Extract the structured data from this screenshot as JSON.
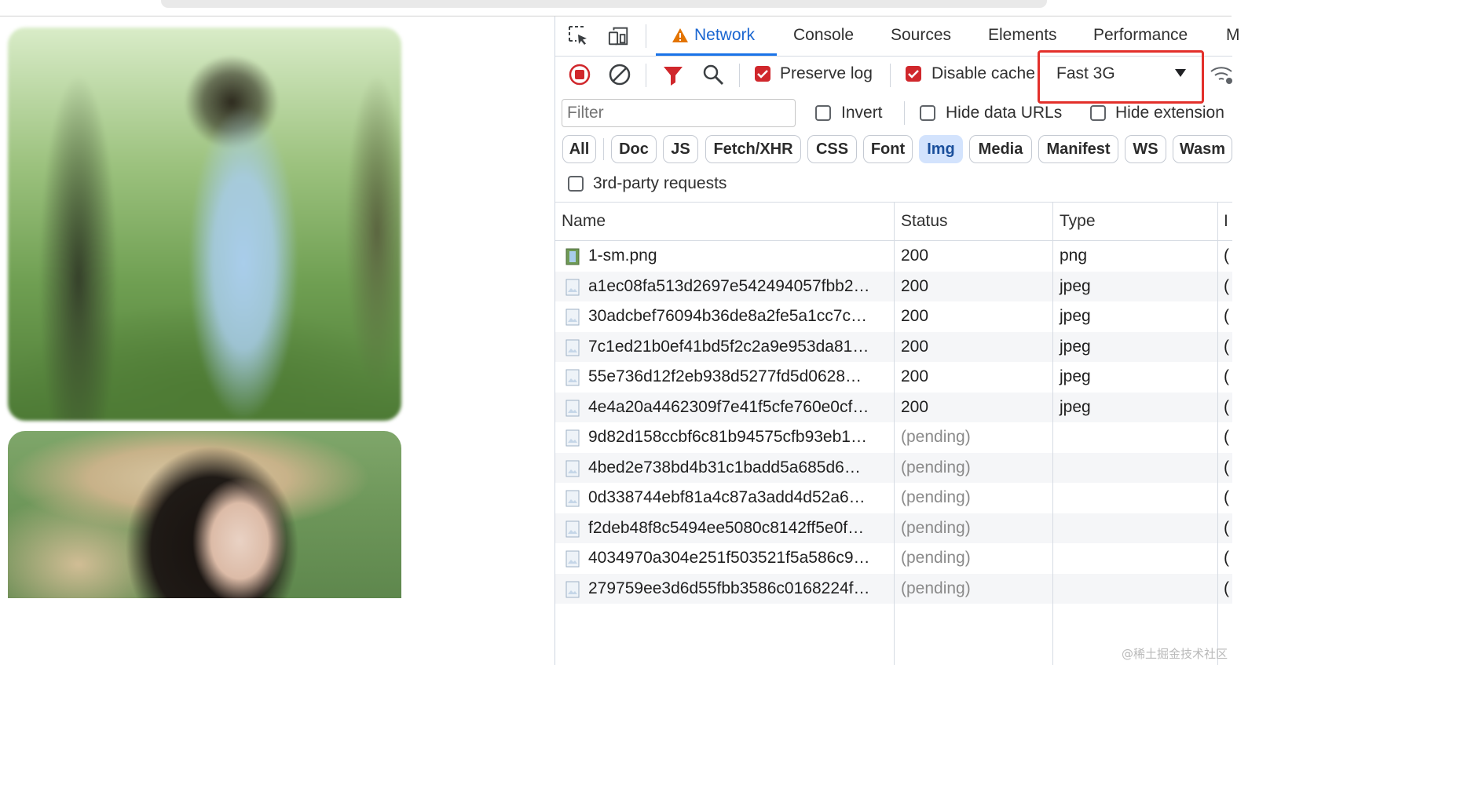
{
  "tabs": [
    {
      "label": "Network",
      "active": true
    },
    {
      "label": "Console"
    },
    {
      "label": "Sources"
    },
    {
      "label": "Elements"
    },
    {
      "label": "Performance"
    },
    {
      "label": "M"
    }
  ],
  "tool_icons": [
    "inspect-element-icon",
    "device-toolbar-icon",
    "warning-icon"
  ],
  "toolbar": {
    "preserve_log": {
      "label": "Preserve log",
      "checked": true
    },
    "disable_cache": {
      "label": "Disable cache",
      "checked": true
    },
    "throttling": "Fast 3G",
    "icons": [
      "record-stop-icon",
      "clear-icon",
      "filter-icon",
      "search-icon",
      "network-conditions-icon"
    ]
  },
  "filter": {
    "placeholder": "Filter",
    "invert": {
      "label": "Invert",
      "checked": false
    },
    "hide_data_urls": {
      "label": "Hide data URLs",
      "checked": false
    },
    "hide_extension": {
      "label": "Hide extension",
      "checked": false
    }
  },
  "type_chips": [
    {
      "label": "All"
    },
    {
      "label": "Doc"
    },
    {
      "label": "JS"
    },
    {
      "label": "Fetch/XHR"
    },
    {
      "label": "CSS"
    },
    {
      "label": "Font"
    },
    {
      "label": "Img",
      "active": true
    },
    {
      "label": "Media"
    },
    {
      "label": "Manifest"
    },
    {
      "label": "WS"
    },
    {
      "label": "Wasm"
    }
  ],
  "third_party": {
    "label": "3rd-party requests",
    "checked": false
  },
  "columns": {
    "name": "Name",
    "status": "Status",
    "type": "Type",
    "initiator": "I"
  },
  "requests": [
    {
      "name": "1-sm.png",
      "status": "200",
      "type": "png",
      "initiator": "("
    },
    {
      "name": "a1ec08fa513d2697e542494057fbb2…",
      "status": "200",
      "type": "jpeg",
      "initiator": "("
    },
    {
      "name": "30adcbef76094b36de8a2fe5a1cc7c…",
      "status": "200",
      "type": "jpeg",
      "initiator": "("
    },
    {
      "name": "7c1ed21b0ef41bd5f2c2a9e953da81…",
      "status": "200",
      "type": "jpeg",
      "initiator": "("
    },
    {
      "name": "55e736d12f2eb938d5277fd5d0628…",
      "status": "200",
      "type": "jpeg",
      "initiator": "("
    },
    {
      "name": "4e4a20a4462309f7e41f5cfe760e0cf…",
      "status": "200",
      "type": "jpeg",
      "initiator": "("
    },
    {
      "name": "9d82d158ccbf6c81b94575cfb93eb1…",
      "status": "(pending)",
      "type": "",
      "initiator": "("
    },
    {
      "name": "4bed2e738bd4b31c1badd5a685d6…",
      "status": "(pending)",
      "type": "",
      "initiator": "("
    },
    {
      "name": "0d338744ebf81a4c87a3add4d52a6…",
      "status": "(pending)",
      "type": "",
      "initiator": "("
    },
    {
      "name": "f2deb48f8c5494ee5080c8142ff5e0f…",
      "status": "(pending)",
      "type": "",
      "initiator": "("
    },
    {
      "name": "4034970a304e251f503521f5a586c9…",
      "status": "(pending)",
      "type": "",
      "initiator": "("
    },
    {
      "name": "279759ee3d6d55fbb3586c0168224f…",
      "status": "(pending)",
      "type": "",
      "initiator": "("
    }
  ],
  "watermark": "@稀土掘金技术社区",
  "colors": {
    "accent": "#1a73e8",
    "record": "#d0272c",
    "highlight_box": "#e3302b",
    "chip_active": "#d3e3fd"
  }
}
